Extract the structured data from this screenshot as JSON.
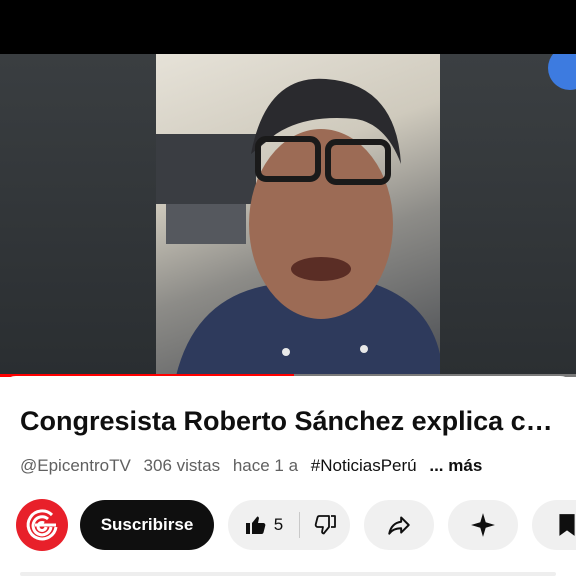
{
  "video": {
    "progress_fraction": 0.51
  },
  "details": {
    "title": "Congresista Roberto Sánchez explica có…",
    "channel_handle": "@EpicentroTV",
    "views": "306 vistas",
    "time_ago": "hace 1 a",
    "hashtag": "#NoticiasPerú",
    "more_label": "... más"
  },
  "actions": {
    "subscribe_label": "Suscribirse",
    "like_count": "5",
    "icons": [
      "epicentro-logo-icon",
      "thumbs-up-icon",
      "thumbs-down-icon",
      "share-icon",
      "sparkle-icon",
      "bookmark-icon"
    ]
  },
  "colors": {
    "accent_red": "#ff0000",
    "logo_red": "#e8202a",
    "subscribe_bg": "#0f0f0f",
    "pill_bg": "#f0f0f0"
  }
}
